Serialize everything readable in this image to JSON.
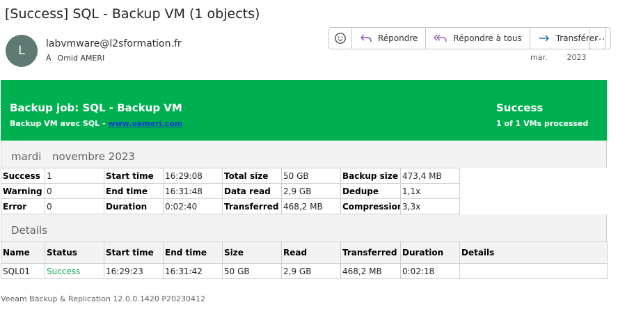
{
  "email": {
    "subject": "[Success] SQL - Backup VM (1 objects)",
    "avatar_initial": "L",
    "sender": "labvmware@l2sformation.fr",
    "to_prefix": "À",
    "to_name": "Omid AMERI",
    "date_day": "mar.",
    "date_year": "2023"
  },
  "actions": {
    "emoji_icon": "smiley-icon",
    "reply": "Répondre",
    "reply_all": "Répondre à tous",
    "forward": "Transférer",
    "more": "···"
  },
  "report": {
    "colors": {
      "banner": "#00b050",
      "link": "#0b3ec9",
      "success_text": "#00b050"
    },
    "banner": {
      "job_title": "Backup job: SQL - Backup VM",
      "job_sub_prefix": "Backup VM avec SQL - ",
      "job_sub_link": "www.oameri.com",
      "status_title": "Success",
      "status_sub": "1 of 1 VMs processed"
    },
    "session_day": "mardi",
    "session_month": "novembre 2023",
    "summary": [
      [
        {
          "label": "Success",
          "value": "1"
        },
        {
          "label": "Start time",
          "value": "16:29:08"
        },
        {
          "label": "Total size",
          "value": "50 GB"
        },
        {
          "label": "Backup size",
          "value": "473,4 MB"
        }
      ],
      [
        {
          "label": "Warning",
          "value": "0"
        },
        {
          "label": "End time",
          "value": "16:31:48"
        },
        {
          "label": "Data read",
          "value": "2,9 GB"
        },
        {
          "label": "Dedupe",
          "value": "1,1x"
        }
      ],
      [
        {
          "label": "Error",
          "value": "0"
        },
        {
          "label": "Duration",
          "value": "0:02:40"
        },
        {
          "label": "Transferred",
          "value": "468,2 MB"
        },
        {
          "label": "Compression",
          "value": "3,3x"
        }
      ]
    ],
    "details_title": "Details",
    "details_headers": [
      "Name",
      "Status",
      "Start time",
      "End time",
      "Size",
      "Read",
      "Transferred",
      "Duration",
      "Details"
    ],
    "details_rows": [
      [
        "SQL01",
        "Success",
        "16:29:23",
        "16:31:42",
        "50 GB",
        "2,9 GB",
        "468,2 MB",
        "0:02:18",
        ""
      ]
    ],
    "footer": "Veeam Backup & Replication 12.0.0.1420 P20230412"
  }
}
